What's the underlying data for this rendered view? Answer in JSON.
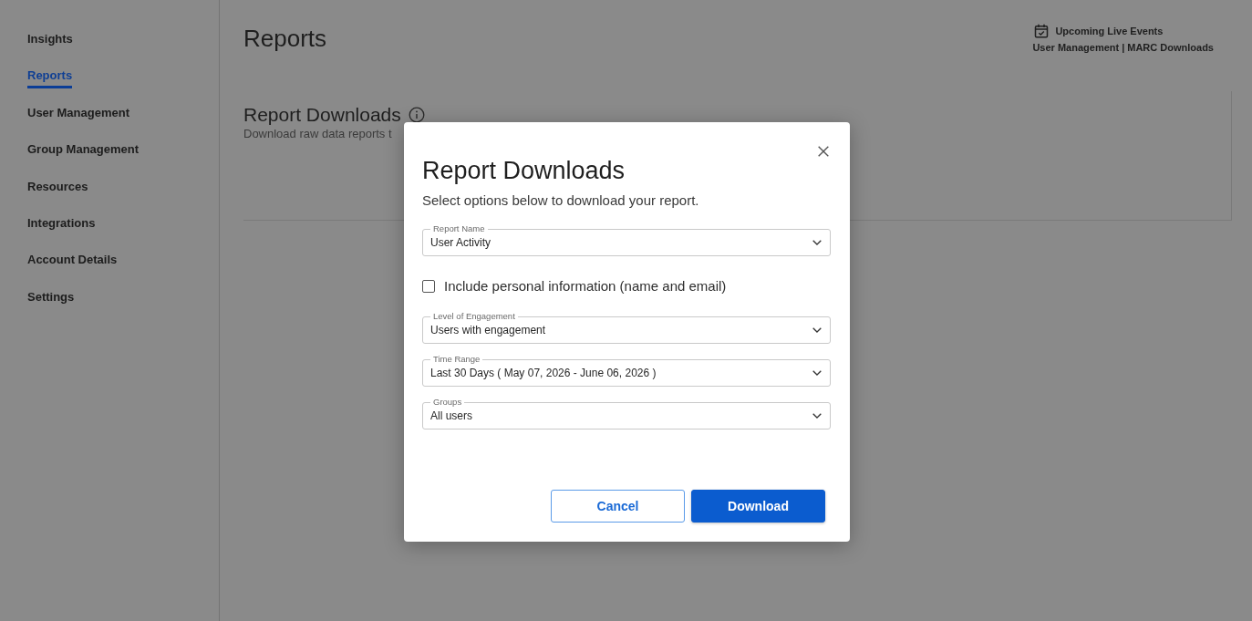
{
  "sidebar": {
    "items": [
      {
        "label": "Insights",
        "selected": false
      },
      {
        "label": "Reports",
        "selected": true
      },
      {
        "label": "User Management",
        "selected": false
      },
      {
        "label": "Group Management",
        "selected": false
      },
      {
        "label": "Resources",
        "selected": false
      },
      {
        "label": "Integrations",
        "selected": false
      },
      {
        "label": "Account Details",
        "selected": false
      },
      {
        "label": "Settings",
        "selected": false
      }
    ]
  },
  "header": {
    "title": "Reports",
    "events_link": "Upcoming Live Events",
    "quick_links": [
      "User Management",
      "MARC Downloads"
    ],
    "separator": "|"
  },
  "card": {
    "title": "Report Downloads",
    "subtitle": "Download raw data reports t"
  },
  "dialog": {
    "title": "Report Downloads",
    "subtitle": "Select options below to download your report.",
    "fields": [
      {
        "kind": "select",
        "label": "Report Name",
        "value": "User Activity"
      },
      {
        "kind": "checkbox",
        "label": "Include personal information (name and email)",
        "checked": false
      },
      {
        "kind": "select",
        "label": "Level of Engagement",
        "value": "Users with engagement"
      },
      {
        "kind": "select",
        "label": "Time Range",
        "value": "Last 30 Days ( May 07, 2026 - June 06, 2026 )"
      },
      {
        "kind": "select",
        "label": "Groups",
        "value": "All users"
      }
    ],
    "buttons": [
      {
        "kind": "secondary",
        "label": "Cancel"
      },
      {
        "kind": "primary",
        "label": "Download"
      }
    ]
  }
}
